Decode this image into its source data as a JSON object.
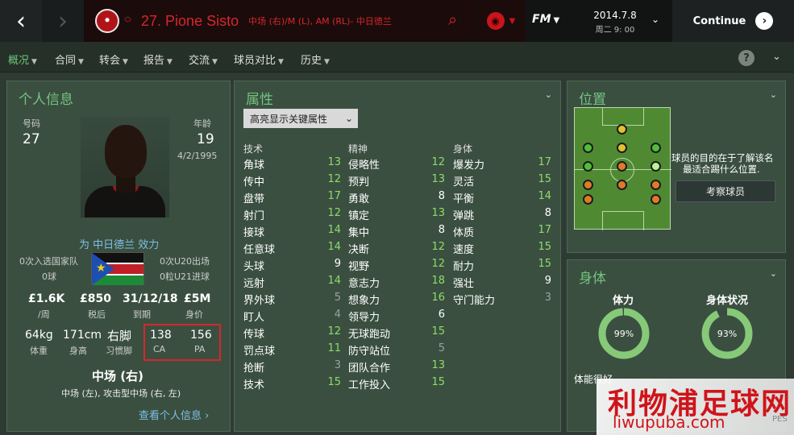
{
  "topbar": {
    "back_icon": "chevron-left-icon",
    "forward_icon": "chevron-right-icon",
    "player_title": "27. Pione Sisto",
    "player_positions": "中场 (右)/M (L), AM (RL)- 中日德兰",
    "date": "2014.7.8",
    "time": "周二 9: 00",
    "fm_label": "FM",
    "continue_label": "Continue"
  },
  "tabs": [
    {
      "label": "概况",
      "dropdown": true
    },
    {
      "label": "合同",
      "dropdown": true
    },
    {
      "label": "转会",
      "dropdown": true
    },
    {
      "label": "报告",
      "dropdown": true
    },
    {
      "label": "交流",
      "dropdown": true
    },
    {
      "label": "球员对比",
      "dropdown": true
    },
    {
      "label": "历史",
      "dropdown": true
    }
  ],
  "help_label": "?",
  "personal": {
    "title": "个人信息",
    "number_label": "号码",
    "number": "27",
    "age_label": "年龄",
    "age": "19",
    "dob": "4/2/1995",
    "club_line": "为 中日德兰 效力",
    "intl_caps": "0次入选国家队",
    "intl_goals": "0球",
    "u20_caps": "0次U20出场",
    "u21_goals": "0粒U21进球",
    "wage": "£1.6K",
    "wage_label": "/周",
    "after_tax": "£850",
    "after_tax_label": "税后",
    "expires": "31/12/18",
    "expires_label": "到期",
    "value": "£5M",
    "value_label": "身价",
    "weight": "64kg",
    "weight_label": "体重",
    "height": "171cm",
    "height_label": "身高",
    "foot": "右脚",
    "foot_label": "习惯脚",
    "ca": "138",
    "ca_label": "CA",
    "pa": "156",
    "pa_label": "PA",
    "position_main": "中场 (右)",
    "position_detail": "中场 (左), 攻击型中场 (右, 左)",
    "profile_link": "查看个人信息 ›"
  },
  "attributes": {
    "title": "属性",
    "dropdown_label": "高亮显示关键属性",
    "columns": [
      {
        "header": "技术",
        "items": [
          {
            "name": "角球",
            "value": "13"
          },
          {
            "name": "传中",
            "value": "12"
          },
          {
            "name": "盘带",
            "value": "17"
          },
          {
            "name": "射门",
            "value": "12"
          },
          {
            "name": "接球",
            "value": "14"
          },
          {
            "name": "任意球",
            "value": "14"
          },
          {
            "name": "头球",
            "value": "9"
          },
          {
            "name": "远射",
            "value": "14"
          },
          {
            "name": "界外球",
            "value": "5"
          },
          {
            "name": "盯人",
            "value": "4"
          },
          {
            "name": "传球",
            "value": "12"
          },
          {
            "name": "罚点球",
            "value": "11"
          },
          {
            "name": "抢断",
            "value": "3"
          },
          {
            "name": "技术",
            "value": "15"
          }
        ]
      },
      {
        "header": "精神",
        "items": [
          {
            "name": "侵略性",
            "value": "12"
          },
          {
            "name": "预判",
            "value": "13"
          },
          {
            "name": "勇敢",
            "value": "8"
          },
          {
            "name": "镇定",
            "value": "13"
          },
          {
            "name": "集中",
            "value": "8"
          },
          {
            "name": "决断",
            "value": "12"
          },
          {
            "name": "视野",
            "value": "12"
          },
          {
            "name": "意志力",
            "value": "18"
          },
          {
            "name": "想象力",
            "value": "16"
          },
          {
            "name": "领导力",
            "value": "6"
          },
          {
            "name": "无球跑动",
            "value": "15"
          },
          {
            "name": "防守站位",
            "value": "5"
          },
          {
            "name": "团队合作",
            "value": "13"
          },
          {
            "name": "工作投入",
            "value": "15"
          }
        ]
      },
      {
        "header": "身体",
        "items": [
          {
            "name": "爆发力",
            "value": "17"
          },
          {
            "name": "灵活",
            "value": "15"
          },
          {
            "name": "平衡",
            "value": "14"
          },
          {
            "name": "弹跳",
            "value": "8"
          },
          {
            "name": "体质",
            "value": "17"
          },
          {
            "name": "速度",
            "value": "15"
          },
          {
            "name": "耐力",
            "value": "15"
          },
          {
            "name": "强壮",
            "value": "9"
          },
          {
            "name": "守门能力",
            "value": "3"
          }
        ]
      }
    ],
    "colors": {
      "high": "#8fdc6a",
      "mid": "#ffffff",
      "low": "#9aa39c"
    }
  },
  "position": {
    "title": "位置",
    "description_line1": "球员的目的在于了解该名",
    "description_line2": "最适合踢什么位置.",
    "scout_button": "考察球员",
    "dots": [
      {
        "row": "AM",
        "col": "C",
        "color": "#e2c230"
      },
      {
        "row": "AML",
        "col": "L",
        "color": "#4fbf3a"
      },
      {
        "row": "AMC",
        "col": "C",
        "color": "#e2c230"
      },
      {
        "row": "AMR",
        "col": "R",
        "color": "#4fbf3a"
      },
      {
        "row": "ML",
        "col": "L",
        "color": "#4fbf3a"
      },
      {
        "row": "MC",
        "col": "C",
        "color": "#e07a28"
      },
      {
        "row": "MR",
        "col": "R",
        "color": "#b8f590"
      },
      {
        "row": "DML",
        "col": "L",
        "color": "#e07a28"
      },
      {
        "row": "DMC",
        "col": "C",
        "color": "#e07a28"
      },
      {
        "row": "DMR",
        "col": "R",
        "color": "#e07a28"
      },
      {
        "row": "DL",
        "col": "L",
        "color": "#e07a28"
      },
      {
        "row": "DR",
        "col": "R",
        "color": "#e07a28"
      }
    ]
  },
  "physical": {
    "title": "身体",
    "stamina_label": "体力",
    "stamina_value": "99%",
    "stamina_fraction": 0.99,
    "condition_label": "身体状况",
    "condition_value": "93%",
    "condition_fraction": 0.93,
    "note": "体能很好"
  },
  "watermark": {
    "line1": "利物浦足球网",
    "line2": "liwupuba.com",
    "tag": "PES"
  },
  "accent_colors": {
    "green": "#74c27f",
    "red": "#d8262c"
  }
}
